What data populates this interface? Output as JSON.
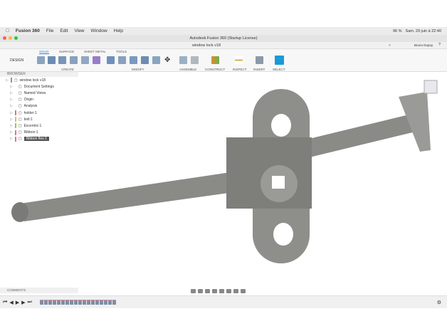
{
  "menubar": {
    "app": "Fusion 360",
    "items": [
      "File",
      "Edit",
      "View",
      "Window",
      "Help"
    ],
    "battery": "96 %",
    "datetime": "Sam. 29 juin à 22:40"
  },
  "window": {
    "title": "Autodesk Fusion 360 (Startup License)"
  },
  "document_tab": {
    "title": "window lock v18",
    "user": "Bruno Dupuy"
  },
  "toolbar": {
    "workspace": "DESIGN",
    "tabs": [
      "SOLID",
      "SURFACE",
      "SHEET METAL",
      "TOOLS"
    ],
    "groups": [
      "CREATE",
      "MODIFY",
      "ASSEMBLE",
      "CONSTRUCT",
      "INSPECT",
      "INSERT",
      "SELECT"
    ]
  },
  "browser": {
    "title": "BROWSER",
    "items": [
      {
        "label": "window lock v18",
        "color": "#c070c0"
      },
      {
        "label": "Document Settings",
        "color": ""
      },
      {
        "label": "Named Views",
        "color": ""
      },
      {
        "label": "Origin",
        "color": ""
      },
      {
        "label": "Analysis",
        "color": ""
      },
      {
        "label": "holder:1",
        "color": "#e07080"
      },
      {
        "label": "bolt:1",
        "color": "#e0c040"
      },
      {
        "label": "Excentric:1",
        "color": "#90d050"
      },
      {
        "label": "Ribbon:1",
        "color": "#e070a0"
      },
      {
        "label": "Ribbon flex:1",
        "color": "#e07090"
      }
    ]
  },
  "comments": {
    "label": "COMMENTS"
  },
  "colors": {
    "accent": "#2a82d8",
    "model": "#8a8a86"
  }
}
